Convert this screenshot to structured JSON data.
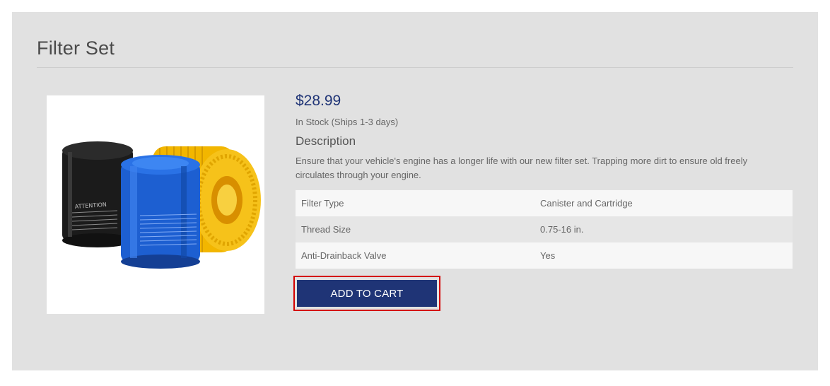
{
  "product": {
    "title": "Filter Set",
    "price": "$28.99",
    "stock": "In Stock (Ships 1-3 days)",
    "description_heading": "Description",
    "description": "Ensure that your vehicle's engine has a longer life with our new filter set. Trapping more dirt to ensure old freely circulates through your engine.",
    "specs": [
      {
        "label": "Filter Type",
        "value": "Canister and Cartridge"
      },
      {
        "label": "Thread Size",
        "value": "0.75-16 in."
      },
      {
        "label": "Anti-Drainback Valve",
        "value": "Yes"
      }
    ],
    "add_to_cart_label": "ADD TO CART",
    "image_text": "ATTENTION"
  },
  "colors": {
    "accent": "#1f3476",
    "panel": "#e1e1e1",
    "highlight_border": "#d40000"
  }
}
